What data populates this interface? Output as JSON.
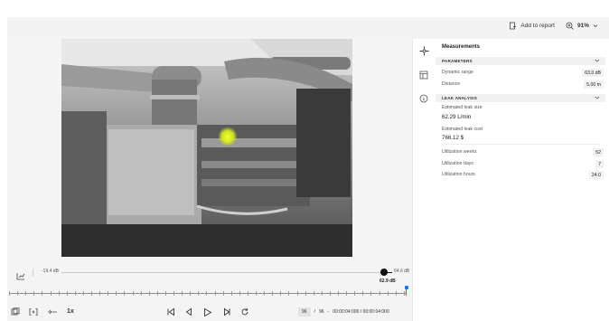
{
  "toolbar": {
    "add_to_report_label": "Add to report",
    "zoom_label": "91%"
  },
  "slider": {
    "min_label": "-19.4 dB",
    "max_label": "64.6 dB",
    "current_label": "62.9 dB",
    "knob_level_fraction": 0.98
  },
  "timeline": {
    "position_fraction": 0.99
  },
  "controls": {
    "speed_label": "1x"
  },
  "frame": {
    "current": "96",
    "separator": "/",
    "total": "96",
    "dash": "-",
    "time_label": "00:00:04:000 / 00:00:04:000"
  },
  "panel": {
    "title": "Measurements",
    "parameters": {
      "header": "PARAMETERS",
      "rows": [
        {
          "label": "Dynamic range",
          "value": "63.0 dB"
        },
        {
          "label": "Distance",
          "value": "5.00 m"
        }
      ]
    },
    "leak": {
      "header": "LEAK ANALYSIS",
      "size_label": "Estimated leak size",
      "size_value": "62.29 L/min",
      "cost_label": "Estimated leak cost",
      "cost_value": "766.12 $",
      "rows": [
        {
          "label": "Utilization weeks",
          "value": "52"
        },
        {
          "label": "Utilization days",
          "value": "7"
        },
        {
          "label": "Utilization hours",
          "value": "24.0"
        }
      ]
    }
  },
  "colors": {
    "accent": "#1a73e8",
    "hotspot": "#e8f21a"
  },
  "icons": [
    "report-icon",
    "zoom-icon",
    "crosshair-icon",
    "layers-icon",
    "info-icon",
    "scale-icon",
    "snapshot-icon",
    "bracket-icon",
    "link-icon",
    "skip-back-icon",
    "step-back-icon",
    "play-icon",
    "step-forward-icon",
    "replay-icon",
    "chevron-down-icon"
  ]
}
